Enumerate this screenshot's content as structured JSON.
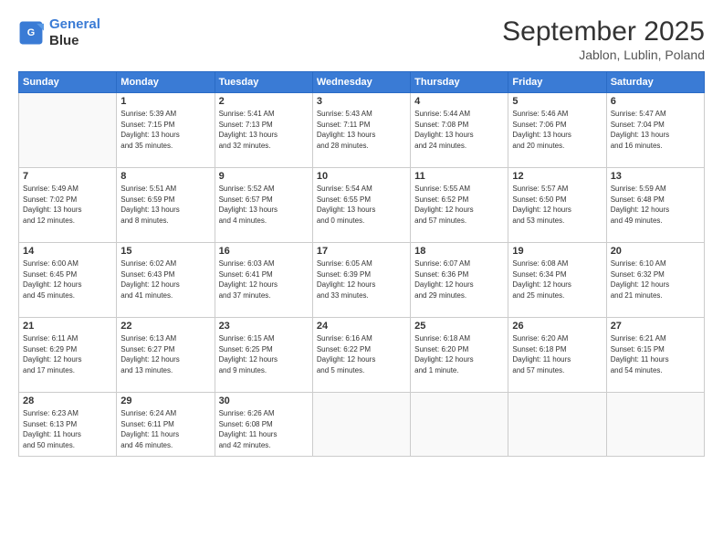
{
  "logo": {
    "line1": "General",
    "line2": "Blue"
  },
  "title": "September 2025",
  "location": "Jablon, Lublin, Poland",
  "days_of_week": [
    "Sunday",
    "Monday",
    "Tuesday",
    "Wednesday",
    "Thursday",
    "Friday",
    "Saturday"
  ],
  "weeks": [
    [
      {
        "day": "",
        "content": ""
      },
      {
        "day": "1",
        "content": "Sunrise: 5:39 AM\nSunset: 7:15 PM\nDaylight: 13 hours\nand 35 minutes."
      },
      {
        "day": "2",
        "content": "Sunrise: 5:41 AM\nSunset: 7:13 PM\nDaylight: 13 hours\nand 32 minutes."
      },
      {
        "day": "3",
        "content": "Sunrise: 5:43 AM\nSunset: 7:11 PM\nDaylight: 13 hours\nand 28 minutes."
      },
      {
        "day": "4",
        "content": "Sunrise: 5:44 AM\nSunset: 7:08 PM\nDaylight: 13 hours\nand 24 minutes."
      },
      {
        "day": "5",
        "content": "Sunrise: 5:46 AM\nSunset: 7:06 PM\nDaylight: 13 hours\nand 20 minutes."
      },
      {
        "day": "6",
        "content": "Sunrise: 5:47 AM\nSunset: 7:04 PM\nDaylight: 13 hours\nand 16 minutes."
      }
    ],
    [
      {
        "day": "7",
        "content": "Sunrise: 5:49 AM\nSunset: 7:02 PM\nDaylight: 13 hours\nand 12 minutes."
      },
      {
        "day": "8",
        "content": "Sunrise: 5:51 AM\nSunset: 6:59 PM\nDaylight: 13 hours\nand 8 minutes."
      },
      {
        "day": "9",
        "content": "Sunrise: 5:52 AM\nSunset: 6:57 PM\nDaylight: 13 hours\nand 4 minutes."
      },
      {
        "day": "10",
        "content": "Sunrise: 5:54 AM\nSunset: 6:55 PM\nDaylight: 13 hours\nand 0 minutes."
      },
      {
        "day": "11",
        "content": "Sunrise: 5:55 AM\nSunset: 6:52 PM\nDaylight: 12 hours\nand 57 minutes."
      },
      {
        "day": "12",
        "content": "Sunrise: 5:57 AM\nSunset: 6:50 PM\nDaylight: 12 hours\nand 53 minutes."
      },
      {
        "day": "13",
        "content": "Sunrise: 5:59 AM\nSunset: 6:48 PM\nDaylight: 12 hours\nand 49 minutes."
      }
    ],
    [
      {
        "day": "14",
        "content": "Sunrise: 6:00 AM\nSunset: 6:45 PM\nDaylight: 12 hours\nand 45 minutes."
      },
      {
        "day": "15",
        "content": "Sunrise: 6:02 AM\nSunset: 6:43 PM\nDaylight: 12 hours\nand 41 minutes."
      },
      {
        "day": "16",
        "content": "Sunrise: 6:03 AM\nSunset: 6:41 PM\nDaylight: 12 hours\nand 37 minutes."
      },
      {
        "day": "17",
        "content": "Sunrise: 6:05 AM\nSunset: 6:39 PM\nDaylight: 12 hours\nand 33 minutes."
      },
      {
        "day": "18",
        "content": "Sunrise: 6:07 AM\nSunset: 6:36 PM\nDaylight: 12 hours\nand 29 minutes."
      },
      {
        "day": "19",
        "content": "Sunrise: 6:08 AM\nSunset: 6:34 PM\nDaylight: 12 hours\nand 25 minutes."
      },
      {
        "day": "20",
        "content": "Sunrise: 6:10 AM\nSunset: 6:32 PM\nDaylight: 12 hours\nand 21 minutes."
      }
    ],
    [
      {
        "day": "21",
        "content": "Sunrise: 6:11 AM\nSunset: 6:29 PM\nDaylight: 12 hours\nand 17 minutes."
      },
      {
        "day": "22",
        "content": "Sunrise: 6:13 AM\nSunset: 6:27 PM\nDaylight: 12 hours\nand 13 minutes."
      },
      {
        "day": "23",
        "content": "Sunrise: 6:15 AM\nSunset: 6:25 PM\nDaylight: 12 hours\nand 9 minutes."
      },
      {
        "day": "24",
        "content": "Sunrise: 6:16 AM\nSunset: 6:22 PM\nDaylight: 12 hours\nand 5 minutes."
      },
      {
        "day": "25",
        "content": "Sunrise: 6:18 AM\nSunset: 6:20 PM\nDaylight: 12 hours\nand 1 minute."
      },
      {
        "day": "26",
        "content": "Sunrise: 6:20 AM\nSunset: 6:18 PM\nDaylight: 11 hours\nand 57 minutes."
      },
      {
        "day": "27",
        "content": "Sunrise: 6:21 AM\nSunset: 6:15 PM\nDaylight: 11 hours\nand 54 minutes."
      }
    ],
    [
      {
        "day": "28",
        "content": "Sunrise: 6:23 AM\nSunset: 6:13 PM\nDaylight: 11 hours\nand 50 minutes."
      },
      {
        "day": "29",
        "content": "Sunrise: 6:24 AM\nSunset: 6:11 PM\nDaylight: 11 hours\nand 46 minutes."
      },
      {
        "day": "30",
        "content": "Sunrise: 6:26 AM\nSunset: 6:08 PM\nDaylight: 11 hours\nand 42 minutes."
      },
      {
        "day": "",
        "content": ""
      },
      {
        "day": "",
        "content": ""
      },
      {
        "day": "",
        "content": ""
      },
      {
        "day": "",
        "content": ""
      }
    ]
  ]
}
